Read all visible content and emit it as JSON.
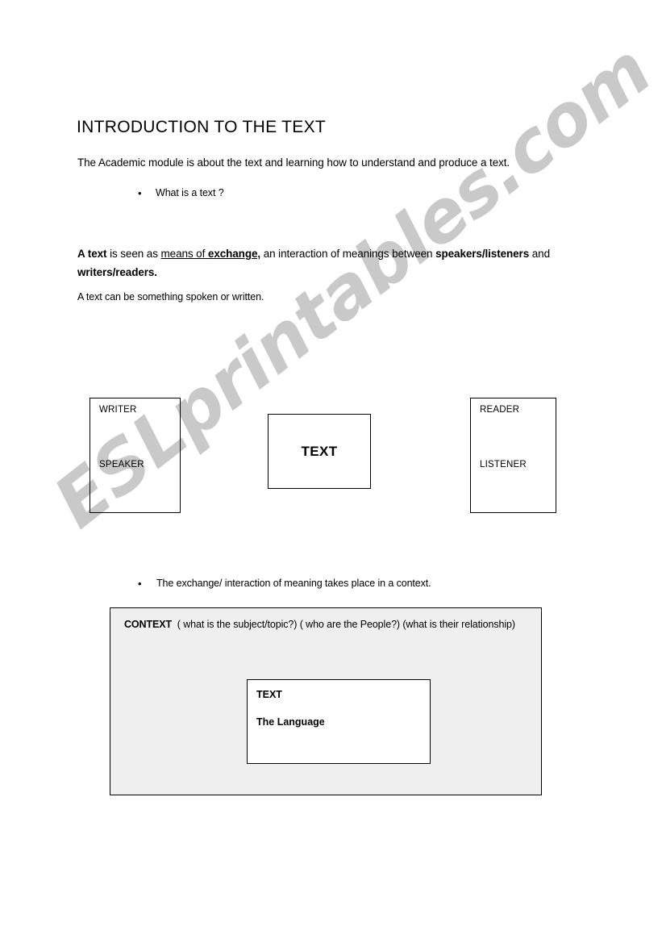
{
  "document": {
    "title": "INTRODUCTION TO THE TEXT",
    "intro": "The Academic module is about the text and learning how to understand and produce a text.",
    "bullets": [
      {
        "marker": "•",
        "label": "What is a text ?"
      },
      {
        "marker": "•",
        "label": "The exchange/ interaction of meaning takes place in a context."
      }
    ],
    "definition": {
      "bold_lead": "A text",
      "segment_1": " is seen as ",
      "underlined_plain": "means of ",
      "underlined_bold": "exchange,",
      "segment_2": " an interaction of meanings between ",
      "bold_tail_1": "speakers/listeners",
      "segment_3": " and ",
      "bold_tail_2": "writers/readers."
    },
    "note": "A text can be something spoken or written."
  },
  "diagram": {
    "sender_box": {
      "line_1": "WRITER",
      "line_2": "SPEAKER"
    },
    "center_box": {
      "label": "TEXT"
    },
    "receiver_box": {
      "line_1": "READER",
      "line_2": "LISTENER"
    }
  },
  "context_panel": {
    "heading": "CONTEXT",
    "questions": "( what is the subject/topic?)  ( who are the People?)  (what is their relationship)",
    "inner_box": {
      "line_1": "TEXT",
      "line_2": "The Language"
    },
    "fill_color": "#efefef",
    "border_color": "#000000"
  },
  "watermark": {
    "text": "ESLprintables.com",
    "color": "#c9c9c9"
  }
}
